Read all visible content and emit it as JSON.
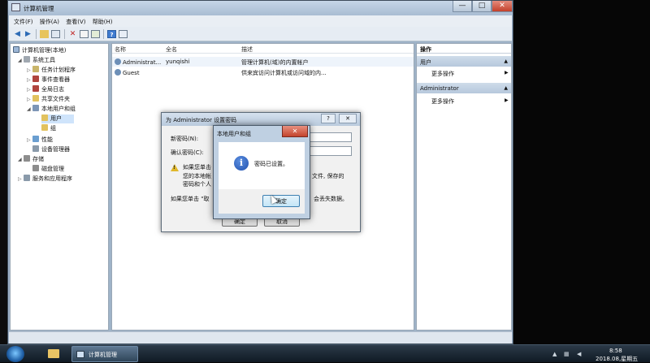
{
  "window": {
    "title": "计算机管理",
    "controls": {
      "minimize": "—",
      "maximize": "□",
      "close": "✕"
    }
  },
  "menubar": [
    "文件(F)",
    "操作(A)",
    "查看(V)",
    "帮助(H)"
  ],
  "tree": {
    "root": "计算机管理(本地)",
    "system_tools": "系统工具",
    "task_scheduler": "任务计划程序",
    "event_viewer": "事件查看器",
    "shared_folders": "共享文件夹",
    "local_users_groups": "本地用户和组",
    "users": "用户",
    "groups": "组",
    "performance": "性能",
    "device_manager": "设备管理器",
    "storage": "存储",
    "disk_management": "磁盘管理",
    "services_apps": "服务和应用程序"
  },
  "list": {
    "headers": [
      "名称",
      "全名",
      "描述"
    ],
    "rows": [
      {
        "name": "Administrat...",
        "fullname": "yunqishi",
        "desc": "管理计算机(域)的内置帐户"
      },
      {
        "name": "Guest",
        "fullname": "",
        "desc": "供来宾访问计算机或访问域的内..."
      }
    ]
  },
  "actions": {
    "title": "操作",
    "section1": "用户",
    "more1": "更多操作",
    "section2": "Administrator",
    "more2": "更多操作"
  },
  "set_password_dialog": {
    "title": "为 Administrator 设置密码",
    "help": "?",
    "close": "✕",
    "new_password_label": "新密码(N):",
    "confirm_password_label": "确认密码(C):",
    "warn_line1": "如果您单击",
    "warn_line2": "您的本地帐",
    "warn_line3": "密码和个人",
    "warn_right": "文件, 保存的",
    "bottom_left": "如果您单击 \"取",
    "bottom_right": "会丢失数据。",
    "ok": "确定",
    "cancel": "取消"
  },
  "message_box": {
    "title": "本地用户和组",
    "close": "✕",
    "text": "密码已设置。",
    "ok": "确定",
    "icon": "info-icon"
  },
  "taskbar": {
    "app_label": "计算机管理",
    "time": "8:58",
    "date": "2018.08,星期五"
  }
}
